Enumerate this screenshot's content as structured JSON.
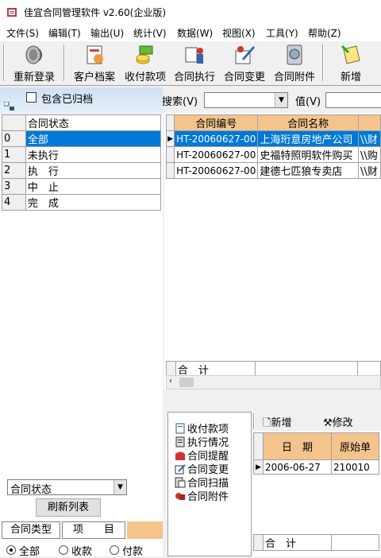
{
  "window": {
    "title": "佳宜合同管理软件 v2.60(企业版)"
  },
  "menu": [
    "文件(S)",
    "编辑(T)",
    "输出(U)",
    "统计(V)",
    "数据(W)",
    "视图(X)",
    "工具(Y)",
    "帮助(Z)"
  ],
  "toolbar": {
    "relogin": "重新登录",
    "customer": "客户档案",
    "payments": "收付款项",
    "execute": "合同执行",
    "change": "合同变更",
    "attach": "合同附件",
    "add": "新增"
  },
  "left": {
    "include_archived": "包含已归档",
    "status_header": "合同状态",
    "statuses": [
      {
        "code": "0",
        "name": "全部"
      },
      {
        "code": "1",
        "name": "未执行"
      },
      {
        "code": "2",
        "name": "执　行"
      },
      {
        "code": "3",
        "name": "中　止"
      },
      {
        "code": "4",
        "name": "完　成"
      }
    ],
    "combo_value": "合同状态",
    "refresh_label": "刷新列表",
    "tabs": [
      "合同类型",
      "项　　目"
    ],
    "radios": [
      "全部",
      "收款",
      "付款"
    ]
  },
  "search": {
    "label": "搜索(V)",
    "value_label": "值(V)"
  },
  "contracts": {
    "headers": [
      "合同编号",
      "合同名称"
    ],
    "rows": [
      {
        "id": "HT-20060627-00",
        "name": "上海珩意房地产公司",
        "path": "\\\\财"
      },
      {
        "id": "HT-20060627-00",
        "name": "史福特照明软件购买",
        "path": "\\\\购"
      },
      {
        "id": "HT-20060627-00",
        "name": "建德七匹狼专卖店",
        "path": "\\\\财"
      }
    ],
    "sum_label": "合　计"
  },
  "lower": {
    "items": [
      "收付款项",
      "执行情况",
      "合同提醒",
      "合同变更",
      "合同扫描",
      "合同附件"
    ],
    "add_label": "新增",
    "edit_label": "修改",
    "headers": [
      "日　期",
      "原始单"
    ],
    "rows": [
      {
        "date": "2006-06-27",
        "code": "210010"
      }
    ],
    "sum_label": "合　计"
  }
}
